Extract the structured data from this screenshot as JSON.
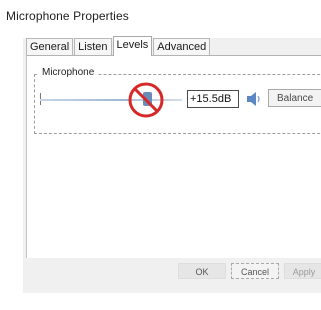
{
  "window": {
    "title": "Microphone Properties"
  },
  "tabs": [
    {
      "label": "General",
      "selected": false
    },
    {
      "label": "Listen",
      "selected": false
    },
    {
      "label": "Levels",
      "selected": true
    },
    {
      "label": "Advanced",
      "selected": false
    }
  ],
  "levels": {
    "group_label": "Microphone",
    "slider_value_fraction": 0.75,
    "level_value": "+15.5dB",
    "speaker_icon": "speaker-icon",
    "balance_label": "Balance",
    "overlay_icon": "prohibited-icon",
    "overlay_color": "#d62828"
  },
  "footer": {
    "ok_label": "OK",
    "cancel_label": "Cancel",
    "apply_label": "Apply"
  }
}
